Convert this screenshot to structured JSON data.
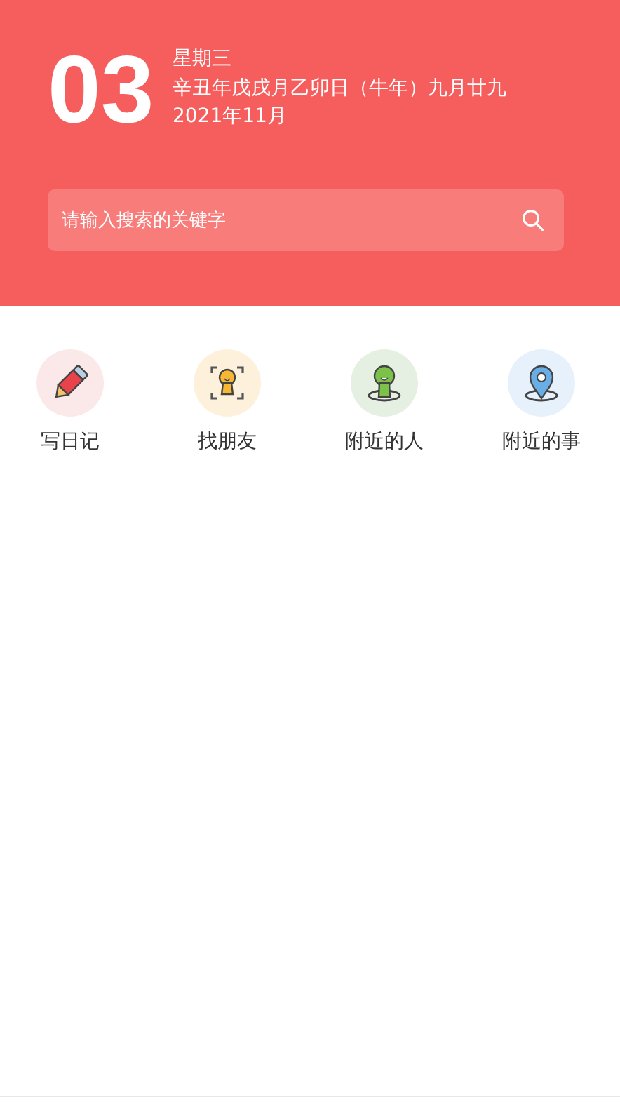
{
  "header": {
    "day": "03",
    "weekday": "星期三",
    "lunar": "辛丑年戊戌月乙卯日（牛年）九月廿九",
    "month": "2021年11月"
  },
  "search": {
    "placeholder": "请输入搜索的关键字"
  },
  "shortcuts": [
    {
      "kind": "pencil",
      "label": "写日记"
    },
    {
      "kind": "friend",
      "label": "找朋友"
    },
    {
      "kind": "people",
      "label": "附近的人"
    },
    {
      "kind": "place",
      "label": "附近的事"
    }
  ]
}
